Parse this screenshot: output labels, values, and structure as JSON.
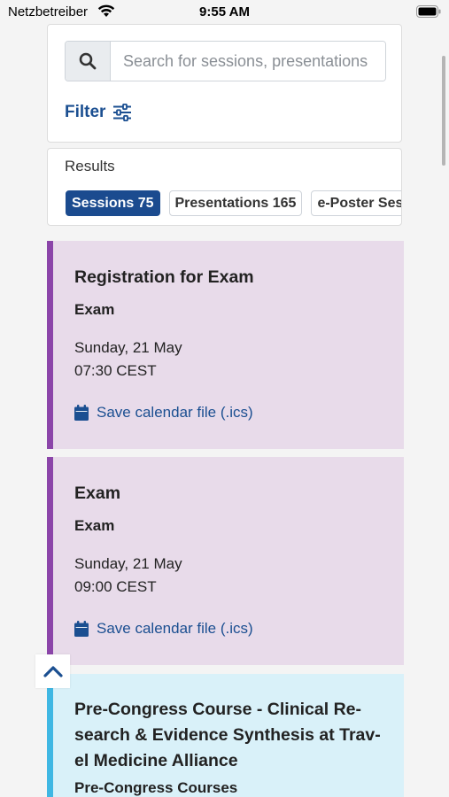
{
  "status": {
    "carrier": "Netzbetreiber",
    "time": "9:55 AM"
  },
  "search": {
    "placeholder": "Search for sessions, presentations"
  },
  "filter": {
    "label": "Filter"
  },
  "results": {
    "title": "Results",
    "chips": [
      {
        "label": "Sessions 75",
        "active": true
      },
      {
        "label": "Presentations 165",
        "active": false
      },
      {
        "label": "e-Poster Sessions",
        "active": false
      }
    ]
  },
  "sessions": [
    {
      "title": "Registration for Exam",
      "type": "Exam",
      "date": "Sunday, 21 May",
      "time": "07:30 CEST",
      "calendar_label": "Save calendar file (.ics)",
      "accent": "#8b45a9"
    },
    {
      "title": "Exam",
      "type": "Exam",
      "date": "Sunday, 21 May",
      "time": "09:00 CEST",
      "calendar_label": "Save calendar file (.ics)",
      "accent": "#8b45a9"
    },
    {
      "title": "Pre-Congress Course - Clinical Re-search & Evidence Synthesis at Trav-el Medicine Alliance",
      "type": "Pre-Congress Courses",
      "accent": "#3fb7e3"
    }
  ],
  "colors": {
    "primary": "#1b4b8f",
    "purple_card": "#e8dbea",
    "blue_card": "#d9f1f9"
  }
}
